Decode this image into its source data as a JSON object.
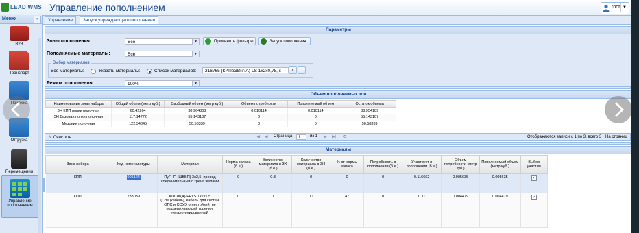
{
  "header": {
    "logo_text": "LEAD WMS",
    "page_title": "Управление пополнением",
    "user": "root",
    "user_menu": "▼"
  },
  "sidebar": {
    "title": "Меню",
    "collapse_glyph": "«",
    "items": [
      {
        "label": "B2B"
      },
      {
        "label": "Транспорт"
      },
      {
        "label": "Приемка"
      },
      {
        "label": "Отгрузка"
      },
      {
        "label": "Перемещения"
      },
      {
        "label": "Управление пополнением"
      }
    ]
  },
  "tabs": [
    {
      "label": "Управление"
    },
    {
      "label": "Запуск упреждающего пополнения"
    }
  ],
  "params": {
    "title": "Параметры",
    "zones_label": "Зоны пополнения:",
    "zones_value": "Все",
    "materials_label": "Пополняемые материалы:",
    "materials_value": "Все",
    "apply_button": "Применить фильтры",
    "run_button": "Запуск пополнения",
    "fieldset_legend": "Выбор материалов",
    "all_materials_label": "Все материалы:",
    "specify_label": "Указать материалы:",
    "list_label": "Список материалов:",
    "list_value": "216765 (КИПвЭВнг(А)-LS 1x2x0,78, к",
    "mode_label": "Режим пополнения:",
    "mode_value": "100%"
  },
  "zones_panel": {
    "title": "Объем пополняемых зон",
    "columns": [
      "Наименование зоны набора",
      "Общий объем (метр куб.)",
      "Свободный объем (метр куб.)",
      "Объем потребности",
      "Пополняемый объем",
      "Остаток объема"
    ],
    "rows": [
      [
        "ЗН КПП полки полочная",
        "60.42264",
        "38.964303",
        "0.010114",
        "0.010114",
        "38.954189"
      ],
      [
        "ЗН Базовая полки полочная",
        "117.14772",
        "55.143107",
        "0",
        "0",
        "55.143107"
      ],
      [
        "Мезонин полочная",
        "122.34845",
        "50.58339",
        "0",
        "0",
        "50.58339"
      ]
    ],
    "clear_button": "Очистить",
    "pager": {
      "page_label": "Страница",
      "page_value": "1",
      "of_label": "из 1",
      "info": "Отображаются записи с 1 по 3, всего 3",
      "per_page": "На страниц"
    }
  },
  "materials_panel": {
    "title": "Материалы",
    "columns": [
      "Зона набора",
      "Код номенклатуры",
      "Материал",
      "Норма запаса (б.е.)",
      "Количество материала в ЗХ (б.е.)",
      "Количество материала в ЗН (б.е.)",
      "% от нормы запаса",
      "Потребность в пополнении (б.е.)",
      "Участвует в пополнении (б.е.)",
      "Объем потребности (метр куб.)",
      "Пополняемый объем (метр куб.)",
      "Выбор участия"
    ],
    "rows": [
      {
        "zone": "КПП",
        "code": "006124",
        "material": "ПуГНП (ШВВП) 3х2,5, провод соединительный с треня желами",
        "norm": "0",
        "qty_zh": "0.3",
        "qty_zn": "0",
        "pct": "0",
        "need": "0",
        "part": "0.116662",
        "vol_need": "0.005635",
        "vol_fill": "0.005635",
        "checked": true
      },
      {
        "zone": "КПП",
        "code": "233039",
        "material": "КПСнг(А)-FRLS 1x2x1,5 (Спецкабель), кабель для систем ОПС и СОУЭ огнестойкий, не поддерживающий горения, негалогенированный",
        "norm": "0",
        "qty_zh": "1",
        "qty_zn": "0.1",
        "pct": "47",
        "need": "0",
        "part": "0.11",
        "vol_need": "0.004479",
        "vol_fill": "0.004479",
        "checked": true
      }
    ]
  },
  "colors": {
    "header_title": "#15428b",
    "panel_border": "#99bbe8",
    "panel_bg": "#dfe8f6",
    "selection": "#3a6fd0"
  }
}
